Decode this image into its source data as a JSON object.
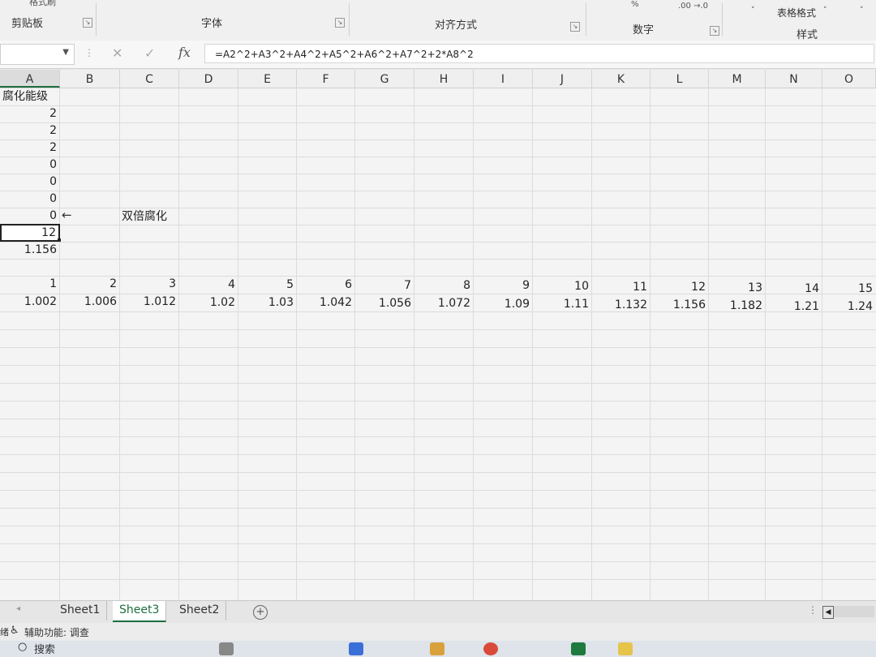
{
  "ribbon": {
    "top_stub_text": "格式刷",
    "groups": [
      {
        "label": "剪贴板"
      },
      {
        "label": "字体"
      },
      {
        "label": "对齐方式"
      },
      {
        "label": "数字"
      },
      {
        "label": "样式"
      }
    ],
    "table_format_label": "表格格式",
    "number_top": "%",
    "decimal_icons": ".00 →.0"
  },
  "formula_bar": {
    "name_box": "",
    "formula": "=A2^2+A3^2+A4^2+A5^2+A6^2+A7^2+2*A8^2"
  },
  "columns": [
    "A",
    "B",
    "C",
    "D",
    "E",
    "F",
    "G",
    "H",
    "I",
    "J",
    "K",
    "L",
    "M",
    "N",
    "O"
  ],
  "cells": {
    "a1": "腐化能级",
    "a2": "2",
    "a3": "2",
    "a4": "2",
    "a5": "0",
    "a6": "0",
    "a7": "0",
    "a8": "0",
    "c8_note": "双倍腐化",
    "a9": "12",
    "a10": "1.156"
  },
  "row12": [
    "1",
    "2",
    "3",
    "4",
    "5",
    "6",
    "7",
    "8",
    "9",
    "10",
    "11",
    "12",
    "13",
    "14",
    "15"
  ],
  "row13": [
    "1.002",
    "1.006",
    "1.012",
    "1.02",
    "1.03",
    "1.042",
    "1.056",
    "1.072",
    "1.09",
    "1.11",
    "1.132",
    "1.156",
    "1.182",
    "1.21",
    "1.24"
  ],
  "sheets": [
    {
      "label": "Sheet1"
    },
    {
      "label": "Sheet3"
    },
    {
      "label": "Sheet2"
    }
  ],
  "status": {
    "accessibility": "辅助功能: 调查"
  },
  "taskbar": {
    "search": "搜索"
  }
}
